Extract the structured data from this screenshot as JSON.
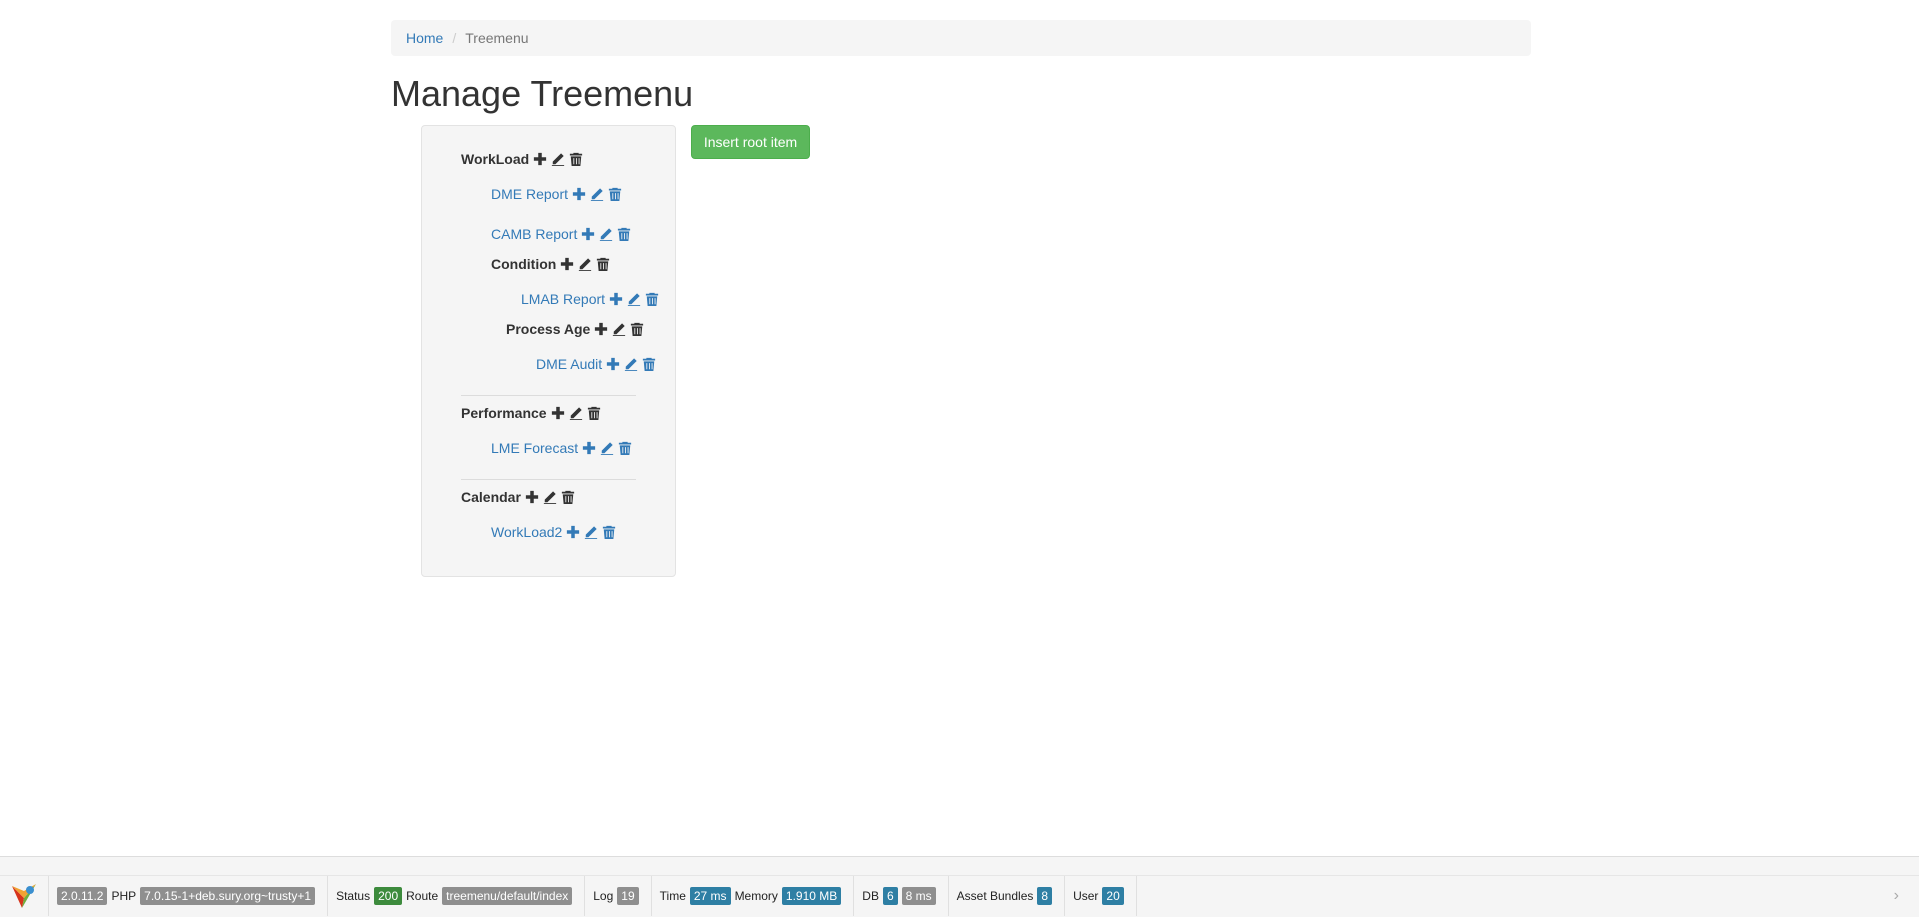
{
  "breadcrumb": {
    "home": "Home",
    "current": "Treemenu"
  },
  "page_title": "Manage Treemenu",
  "insert_root_label": "Insert root item",
  "tree": [
    {
      "label": "WorkLoad",
      "style": "bold"
    },
    {
      "label": "DME Report",
      "style": "link"
    },
    {
      "label": "CAMB Report",
      "style": "link"
    },
    {
      "label": "Condition",
      "style": "bold"
    },
    {
      "label": "LMAB Report",
      "style": "link"
    },
    {
      "label": "Process Age",
      "style": "bold"
    },
    {
      "label": "DME Audit",
      "style": "link"
    },
    {
      "label": "Performance",
      "style": "bold"
    },
    {
      "label": "LME Forecast",
      "style": "link"
    },
    {
      "label": "Calendar",
      "style": "bold"
    },
    {
      "label": "WorkLoad2",
      "style": "link"
    }
  ],
  "icons": [
    "plus-icon",
    "pencil-icon",
    "trash-icon"
  ],
  "toolbar": {
    "yii_version": "2.0.11.2",
    "php_label": "PHP",
    "php_version": "7.0.15-1+deb.sury.org~trusty+1",
    "status_label": "Status",
    "status_value": "200",
    "route_label": "Route",
    "route_value": "treemenu/default/index",
    "log_label": "Log",
    "log_value": "19",
    "time_label": "Time",
    "time_value": "27 ms",
    "memory_label": "Memory",
    "memory_value": "1.910 MB",
    "db_label": "DB",
    "db_queries": "6",
    "db_time": "8 ms",
    "assets_label": "Asset Bundles",
    "assets_value": "8",
    "user_label": "User",
    "user_value": "20",
    "collapse_glyph": "›"
  },
  "colors": {
    "link": "#337ab7",
    "success": "#5cb85c",
    "label_gray": "#8f8f8f",
    "label_green": "#3d8b3d",
    "label_blue": "#2e7fa4"
  }
}
